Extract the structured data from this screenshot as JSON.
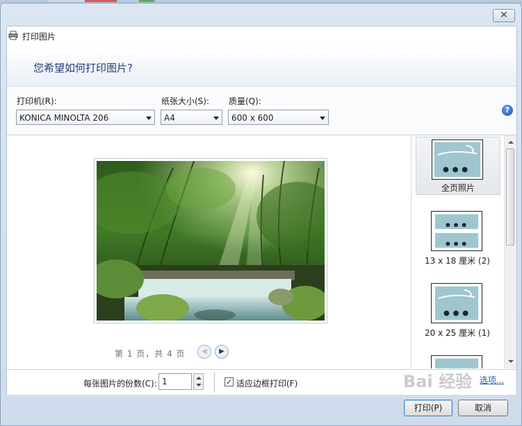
{
  "window": {
    "title": "打印图片",
    "close_label": "✕"
  },
  "header": {
    "question": "您希望如何打印图片?"
  },
  "settings": {
    "printer": {
      "label": "打印机(R):",
      "value": "KONICA MINOLTA 206"
    },
    "paper_size": {
      "label": "纸张大小(S):",
      "value": "A4"
    },
    "quality": {
      "label": "质量(Q):",
      "value": "600 x 600"
    },
    "help_label": "?"
  },
  "preview": {
    "page_info": "第 1 页，共 4 页"
  },
  "layouts": [
    {
      "label": "全页照片",
      "selected": true
    },
    {
      "label": "13 x 18 厘米 (2)",
      "selected": false
    },
    {
      "label": "20 x 25 厘米 (1)",
      "selected": false
    }
  ],
  "footer": {
    "copies_label": "每张图片的份数(C):",
    "copies_value": "1",
    "fit_label": "适应边框打印(F)",
    "fit_checked": true,
    "options_link": "选项..."
  },
  "buttons": {
    "print": "打印(P)",
    "cancel": "取消"
  },
  "watermark": "Bai 经验",
  "colors": {
    "accent": "#1f3d73",
    "link": "#1b5fb4",
    "window_bg": "#dfe8f1"
  }
}
